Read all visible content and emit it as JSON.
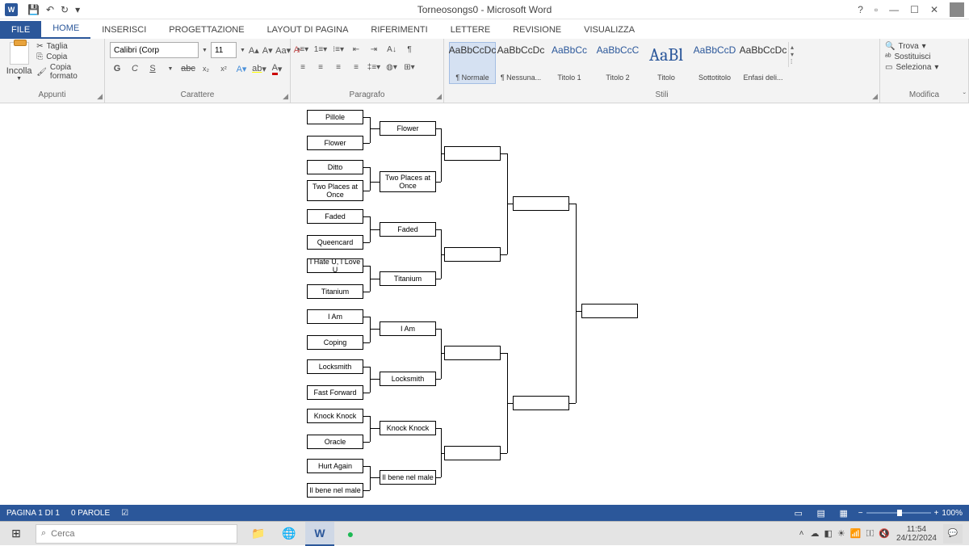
{
  "title": "Torneosongs0 - Microsoft Word",
  "tabs": {
    "file": "FILE",
    "home": "HOME",
    "insert": "INSERISCI",
    "design": "PROGETTAZIONE",
    "layout": "LAYOUT DI PAGINA",
    "ref": "RIFERIMENTI",
    "mail": "LETTERE",
    "review": "REVISIONE",
    "view": "VISUALIZZA"
  },
  "clip": {
    "paste": "Incolla",
    "cut": "Taglia",
    "copy": "Copia",
    "fmt": "Copia formato",
    "label": "Appunti"
  },
  "font": {
    "name": "Calibri (Corp",
    "size": "11",
    "label": "Carattere",
    "bold": "G",
    "italic": "C",
    "underline": "S"
  },
  "para": {
    "label": "Paragrafo"
  },
  "styles": {
    "label": "Stili",
    "items": [
      {
        "prev": "AaBbCcDc",
        "name": "¶ Normale",
        "sel": true
      },
      {
        "prev": "AaBbCcDc",
        "name": "¶ Nessuna..."
      },
      {
        "prev": "AaBbCc",
        "name": "Titolo 1",
        "blue": true
      },
      {
        "prev": "AaBbCcC",
        "name": "Titolo 2",
        "blue": true
      },
      {
        "prev": "AaBl",
        "name": "Titolo",
        "big": true
      },
      {
        "prev": "AaBbCcD",
        "name": "Sottotitolo",
        "blue": true
      },
      {
        "prev": "AaBbCcDc",
        "name": "Enfasi deli..."
      }
    ]
  },
  "edit": {
    "label": "Modifica",
    "find": "Trova",
    "replace": "Sostituisci",
    "select": "Seleziona"
  },
  "bracket": {
    "r1": [
      "Pillole",
      "Flower",
      "Ditto",
      "Two Places at Once",
      "Faded",
      "Queencard",
      "I Hate U, I Love U",
      "Titanium",
      "I Am",
      "Coping",
      "Locksmith",
      "Fast Forward",
      "Knock Knock",
      "Oracle",
      "Hurt Again",
      "Il bene nel male"
    ],
    "r2": [
      "Flower",
      "Two Places at Once",
      "Faded",
      "Titanium",
      "I Am",
      "Locksmith",
      "Knock Knock",
      "Il bene nel male"
    ]
  },
  "status": {
    "page": "PAGINA 1 DI 1",
    "words": "0 PAROLE",
    "zoom": "100%"
  },
  "taskbar": {
    "search": "Cerca",
    "time": "11:54",
    "date": "24/12/2024"
  }
}
